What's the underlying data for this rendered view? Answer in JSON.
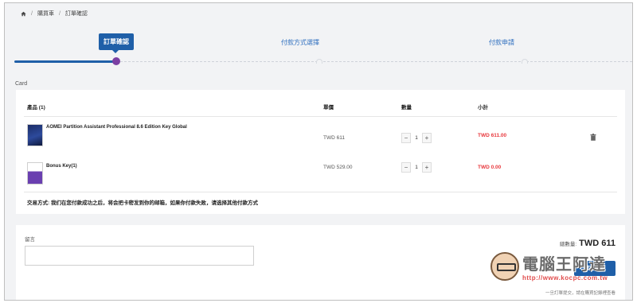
{
  "breadcrumb": {
    "home_icon": "home-icon",
    "items": [
      "購買車",
      "訂單確認"
    ]
  },
  "steps": [
    "訂單確認",
    "付款方式選擇",
    "付款申請"
  ],
  "card_title": "Card",
  "table": {
    "headers": [
      "產品 (1)",
      "單價",
      "數量",
      "小計"
    ],
    "rows": [
      {
        "name": "AOMEI Partition Assistant Professional 8.6 Edition Key Global",
        "price": "TWD 611",
        "qty": "1",
        "subtotal": "TWD 611.00"
      },
      {
        "name": "Bonus Key(1)",
        "price": "TWD 529.00",
        "qty": "1",
        "subtotal": "TWD 0.00"
      }
    ],
    "note": "交易方式: 我们在您付款成功之后，将会把卡密发到你的邮箱，如果你付款失败，请选择其他付款方式"
  },
  "comment": {
    "label": "留言",
    "value": ""
  },
  "total": {
    "label": "總數量:",
    "value": "TWD 611"
  },
  "pay_button": "確定訂單",
  "footnote": "一旦訂單提交，請在購買記錄裡查看",
  "watermark": {
    "title": "電腦王阿達",
    "url": "http://www.kocpc.com.tw"
  },
  "colors": {
    "primary": "#1f5fa8",
    "accent_dot": "#7b3fa3",
    "price_red": "#e8383d"
  }
}
